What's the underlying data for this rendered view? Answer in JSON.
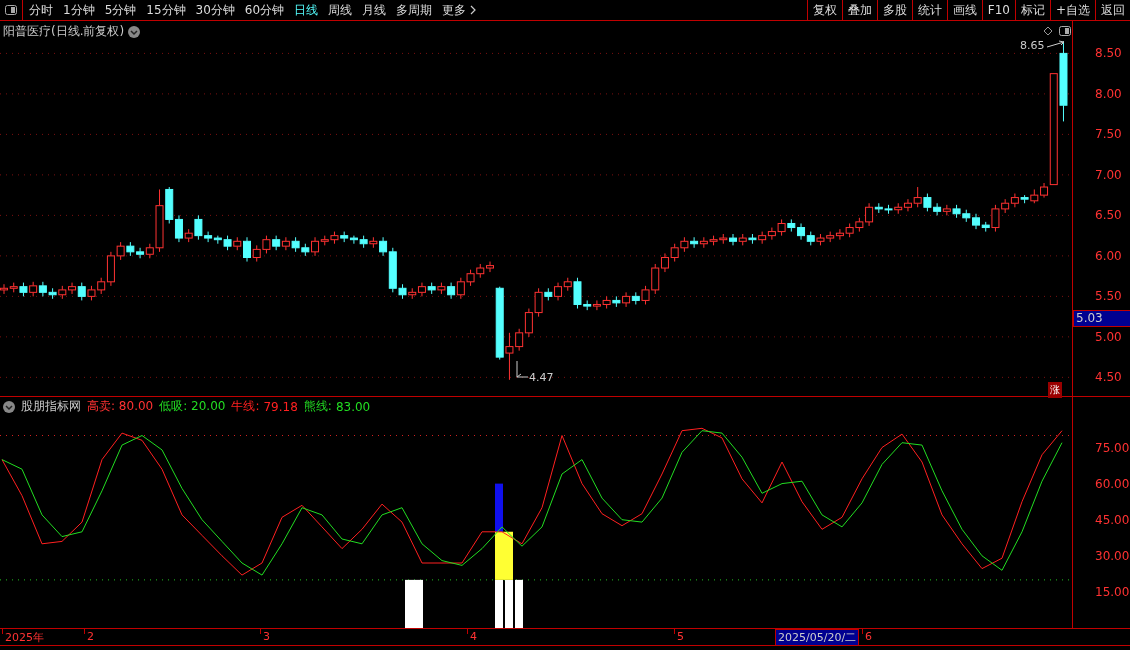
{
  "toolbar": {
    "periods": [
      {
        "label": "分时",
        "selected": false
      },
      {
        "label": "1分钟",
        "selected": false
      },
      {
        "label": "5分钟",
        "selected": false
      },
      {
        "label": "15分钟",
        "selected": false
      },
      {
        "label": "30分钟",
        "selected": false
      },
      {
        "label": "60分钟",
        "selected": false
      },
      {
        "label": "日线",
        "selected": true
      },
      {
        "label": "周线",
        "selected": false
      },
      {
        "label": "月线",
        "selected": false
      },
      {
        "label": "多周期",
        "selected": false
      },
      {
        "label": "更多",
        "selected": false
      }
    ],
    "actions": [
      "复权",
      "叠加",
      "多股",
      "统计",
      "画线",
      "F10",
      "标记",
      "+自选",
      "返回"
    ]
  },
  "price_panel": {
    "title": "阳普医疗(日线.前复权)",
    "high_label": "8.65",
    "low_label": "4.47",
    "current_price": "5.03",
    "badge": "涨",
    "chart_data": {
      "type": "candlestick",
      "grid": true,
      "ylim": [
        4.27,
        8.9
      ],
      "yticks": [
        {
          "value": 8.5,
          "label": "8.50"
        },
        {
          "value": 8,
          "label": "8.00"
        },
        {
          "value": 7.5,
          "label": "7.50"
        },
        {
          "value": 7,
          "label": "7.00"
        },
        {
          "value": 6.5,
          "label": "6.50"
        },
        {
          "value": 6,
          "label": "6.00"
        },
        {
          "value": 5.5,
          "label": "5.50"
        },
        {
          "value": 5,
          "label": "5.00"
        },
        {
          "value": 4.5,
          "label": "4.50"
        }
      ],
      "ohlc": [
        [
          5.58,
          5.65,
          5.53,
          5.6
        ],
        [
          5.6,
          5.67,
          5.55,
          5.62
        ],
        [
          5.62,
          5.67,
          5.5,
          5.55
        ],
        [
          5.55,
          5.68,
          5.5,
          5.63
        ],
        [
          5.63,
          5.68,
          5.5,
          5.55
        ],
        [
          5.55,
          5.6,
          5.47,
          5.52
        ],
        [
          5.52,
          5.63,
          5.47,
          5.58
        ],
        [
          5.58,
          5.67,
          5.53,
          5.62
        ],
        [
          5.62,
          5.67,
          5.45,
          5.5
        ],
        [
          5.5,
          5.63,
          5.45,
          5.58
        ],
        [
          5.58,
          5.73,
          5.53,
          5.68
        ],
        [
          5.68,
          6.05,
          5.63,
          6.0
        ],
        [
          6.0,
          6.17,
          5.95,
          6.12
        ],
        [
          6.12,
          6.17,
          6.0,
          6.05
        ],
        [
          6.05,
          6.1,
          5.97,
          6.02
        ],
        [
          6.02,
          6.15,
          5.97,
          6.1
        ],
        [
          6.1,
          6.82,
          6.05,
          6.62
        ],
        [
          6.82,
          6.85,
          6.4,
          6.45
        ],
        [
          6.45,
          6.5,
          6.17,
          6.22
        ],
        [
          6.22,
          6.33,
          6.17,
          6.28
        ],
        [
          6.45,
          6.5,
          6.2,
          6.25
        ],
        [
          6.25,
          6.3,
          6.17,
          6.22
        ],
        [
          6.22,
          6.25,
          6.15,
          6.2
        ],
        [
          6.2,
          6.25,
          6.07,
          6.12
        ],
        [
          6.12,
          6.23,
          6.07,
          6.18
        ],
        [
          6.18,
          6.23,
          5.93,
          5.98
        ],
        [
          5.98,
          6.13,
          5.93,
          6.08
        ],
        [
          6.08,
          6.25,
          6.03,
          6.2
        ],
        [
          6.2,
          6.25,
          6.07,
          6.12
        ],
        [
          6.12,
          6.23,
          6.07,
          6.18
        ],
        [
          6.18,
          6.23,
          6.05,
          6.1
        ],
        [
          6.1,
          6.15,
          6.0,
          6.05
        ],
        [
          6.05,
          6.23,
          6.0,
          6.18
        ],
        [
          6.18,
          6.25,
          6.13,
          6.2
        ],
        [
          6.2,
          6.3,
          6.15,
          6.25
        ],
        [
          6.25,
          6.3,
          6.17,
          6.22
        ],
        [
          6.22,
          6.25,
          6.15,
          6.2
        ],
        [
          6.2,
          6.25,
          6.1,
          6.15
        ],
        [
          6.15,
          6.23,
          6.1,
          6.18
        ],
        [
          6.18,
          6.23,
          6.0,
          6.05
        ],
        [
          6.05,
          6.1,
          5.55,
          5.6
        ],
        [
          5.6,
          5.65,
          5.47,
          5.52
        ],
        [
          5.52,
          5.6,
          5.47,
          5.55
        ],
        [
          5.55,
          5.67,
          5.5,
          5.62
        ],
        [
          5.62,
          5.67,
          5.53,
          5.58
        ],
        [
          5.58,
          5.67,
          5.53,
          5.62
        ],
        [
          5.62,
          5.67,
          5.47,
          5.52
        ],
        [
          5.52,
          5.73,
          5.47,
          5.68
        ],
        [
          5.68,
          5.83,
          5.63,
          5.78
        ],
        [
          5.78,
          5.9,
          5.73,
          5.85
        ],
        [
          5.85,
          5.93,
          5.8,
          5.88
        ],
        [
          5.6,
          5.62,
          4.72,
          4.75
        ],
        [
          4.8,
          5.05,
          4.47,
          4.88
        ],
        [
          4.88,
          5.1,
          4.83,
          5.05
        ],
        [
          5.05,
          5.35,
          5.0,
          5.3
        ],
        [
          5.3,
          5.6,
          5.25,
          5.55
        ],
        [
          5.55,
          5.6,
          5.45,
          5.5
        ],
        [
          5.5,
          5.67,
          5.45,
          5.62
        ],
        [
          5.62,
          5.73,
          5.57,
          5.68
        ],
        [
          5.68,
          5.73,
          5.35,
          5.4
        ],
        [
          5.4,
          5.45,
          5.33,
          5.38
        ],
        [
          5.38,
          5.45,
          5.33,
          5.4
        ],
        [
          5.4,
          5.5,
          5.35,
          5.45
        ],
        [
          5.45,
          5.5,
          5.37,
          5.42
        ],
        [
          5.42,
          5.55,
          5.37,
          5.5
        ],
        [
          5.5,
          5.55,
          5.4,
          5.45
        ],
        [
          5.45,
          5.63,
          5.4,
          5.58
        ],
        [
          5.58,
          5.9,
          5.53,
          5.85
        ],
        [
          5.85,
          6.03,
          5.8,
          5.98
        ],
        [
          5.98,
          6.15,
          5.93,
          6.1
        ],
        [
          6.1,
          6.23,
          6.05,
          6.18
        ],
        [
          6.18,
          6.23,
          6.1,
          6.15
        ],
        [
          6.15,
          6.23,
          6.1,
          6.18
        ],
        [
          6.18,
          6.25,
          6.13,
          6.2
        ],
        [
          6.2,
          6.27,
          6.15,
          6.22
        ],
        [
          6.22,
          6.27,
          6.13,
          6.18
        ],
        [
          6.18,
          6.27,
          6.13,
          6.22
        ],
        [
          6.22,
          6.27,
          6.15,
          6.2
        ],
        [
          6.2,
          6.3,
          6.15,
          6.25
        ],
        [
          6.25,
          6.35,
          6.2,
          6.3
        ],
        [
          6.3,
          6.45,
          6.25,
          6.4
        ],
        [
          6.4,
          6.45,
          6.3,
          6.35
        ],
        [
          6.35,
          6.4,
          6.2,
          6.25
        ],
        [
          6.25,
          6.3,
          6.13,
          6.18
        ],
        [
          6.18,
          6.27,
          6.13,
          6.22
        ],
        [
          6.22,
          6.3,
          6.17,
          6.25
        ],
        [
          6.25,
          6.33,
          6.2,
          6.28
        ],
        [
          6.28,
          6.4,
          6.23,
          6.35
        ],
        [
          6.35,
          6.47,
          6.3,
          6.42
        ],
        [
          6.42,
          6.65,
          6.37,
          6.6
        ],
        [
          6.6,
          6.65,
          6.53,
          6.58
        ],
        [
          6.58,
          6.63,
          6.52,
          6.57
        ],
        [
          6.57,
          6.65,
          6.52,
          6.6
        ],
        [
          6.6,
          6.7,
          6.55,
          6.65
        ],
        [
          6.65,
          6.85,
          6.6,
          6.72
        ],
        [
          6.72,
          6.77,
          6.55,
          6.6
        ],
        [
          6.6,
          6.65,
          6.5,
          6.55
        ],
        [
          6.55,
          6.63,
          6.5,
          6.58
        ],
        [
          6.58,
          6.63,
          6.47,
          6.52
        ],
        [
          6.52,
          6.57,
          6.42,
          6.47
        ],
        [
          6.47,
          6.52,
          6.33,
          6.38
        ],
        [
          6.38,
          6.42,
          6.3,
          6.35
        ],
        [
          6.35,
          6.63,
          6.3,
          6.58
        ],
        [
          6.58,
          6.7,
          6.53,
          6.65
        ],
        [
          6.65,
          6.77,
          6.6,
          6.72
        ],
        [
          6.72,
          6.75,
          6.65,
          6.7
        ],
        [
          6.68,
          6.82,
          6.65,
          6.75
        ],
        [
          6.75,
          6.9,
          6.72,
          6.85
        ],
        [
          6.88,
          8.25,
          6.88,
          8.25
        ],
        [
          8.5,
          8.65,
          7.66,
          7.86
        ]
      ]
    }
  },
  "indicator_panel": {
    "name": "股朋指标网",
    "values": [
      {
        "label": "高卖:",
        "value": "80.00",
        "color": "#ff3232"
      },
      {
        "label": "低吸:",
        "value": "20.00",
        "color": "#22dd22"
      }
    ],
    "legend_readings": [
      "79.18",
      "83.00"
    ],
    "chart_data": {
      "type": "line",
      "ylim": [
        0,
        96
      ],
      "yticks": [
        {
          "value": 75,
          "label": "75.00"
        },
        {
          "value": 60,
          "label": "60.00"
        },
        {
          "value": 45,
          "label": "45.00"
        },
        {
          "value": 30,
          "label": "30.00"
        },
        {
          "value": 15,
          "label": "15.00"
        }
      ],
      "series": [
        {
          "name": "牛线:",
          "color": "#ff2020",
          "values": [
            70,
            55,
            35,
            36,
            44,
            70,
            81,
            78,
            66,
            47,
            38.5,
            30,
            22,
            27,
            46,
            51,
            42,
            33,
            41,
            51.5,
            44,
            27,
            27,
            27,
            40,
            40,
            35,
            50,
            80,
            60,
            47.5,
            42.5,
            47.5,
            64,
            82,
            83,
            79,
            62,
            52,
            69,
            52.5,
            41,
            46,
            62,
            75,
            80.6,
            69,
            47,
            35,
            24.7,
            29,
            52.5,
            72,
            82
          ]
        },
        {
          "name": "熊线:",
          "color": "#22dd22",
          "values": [
            70,
            66,
            47,
            38,
            40,
            57,
            76,
            80,
            74,
            58,
            45,
            36,
            27,
            22,
            35,
            50,
            47,
            37,
            35,
            47,
            50,
            35,
            28,
            26,
            33,
            42,
            34,
            42,
            64,
            70,
            54,
            45,
            44,
            54,
            73,
            82,
            81,
            71,
            56,
            60,
            61,
            47,
            42,
            52,
            68,
            77,
            76,
            57,
            41,
            30,
            24,
            40,
            61,
            77
          ]
        }
      ]
    }
  },
  "date_axis": [
    "2025年",
    "2",
    "3",
    "4",
    "5",
    "6"
  ],
  "cursor_date": "2025/05/20/二"
}
